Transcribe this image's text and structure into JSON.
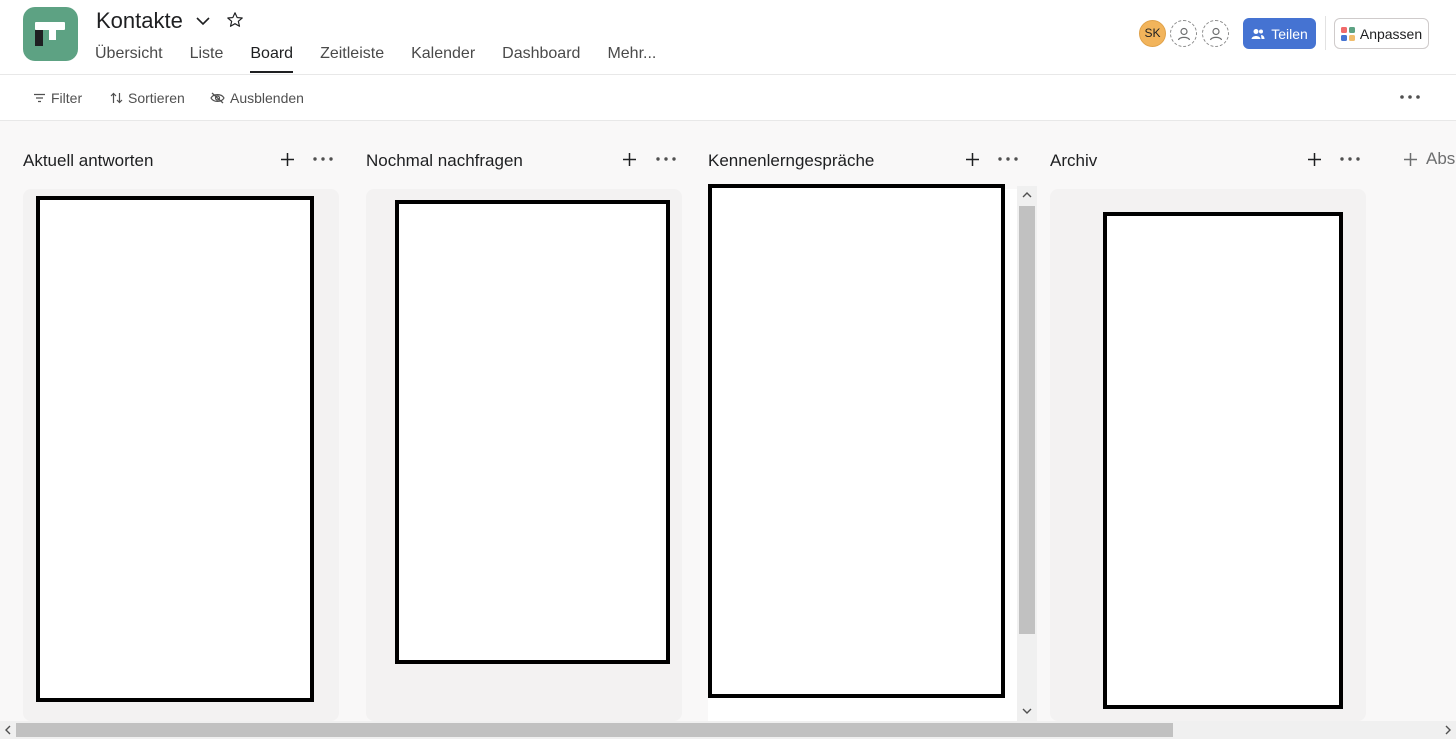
{
  "app": {
    "logo_color": "#5da283",
    "title": "Kontakte"
  },
  "tabs": [
    {
      "label": "Übersicht"
    },
    {
      "label": "Liste"
    },
    {
      "label": "Board"
    },
    {
      "label": "Zeitleiste"
    },
    {
      "label": "Kalender"
    },
    {
      "label": "Dashboard"
    },
    {
      "label": "Mehr..."
    }
  ],
  "active_tab": "Board",
  "header": {
    "avatar_initials": "SK",
    "share_label": "Teilen",
    "customize_label": "Anpassen",
    "accent_color": "#4573d2"
  },
  "toolbar": {
    "filter_label": "Filter",
    "sort_label": "Sortieren",
    "hide_label": "Ausblenden"
  },
  "columns": [
    {
      "title": "Aktuell antworten"
    },
    {
      "title": "Nochmal nachfragen"
    },
    {
      "title": "Kennenlerngespräche"
    },
    {
      "title": "Archiv"
    }
  ],
  "add_section_label": "Abs"
}
